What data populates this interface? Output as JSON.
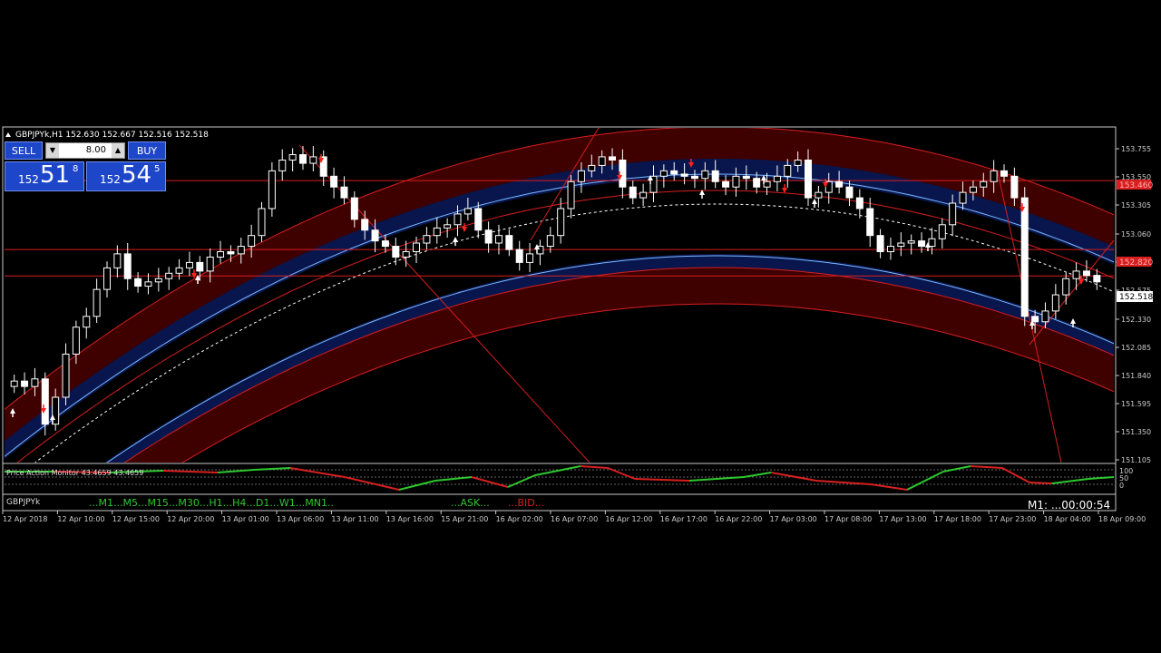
{
  "chart": {
    "header": "GBPJPYk,H1  152.630 152.667 152.516 152.518",
    "symbol_label": "GBPJPYk",
    "current_price_label": "152.518",
    "hline_labels": [
      "153.460",
      "152.820"
    ],
    "timer_label": "M1: ...00:00:54"
  },
  "trade_panel": {
    "sell_label": "SELL",
    "buy_label": "BUY",
    "lot": "8.00",
    "sell_small": "152",
    "sell_big": "51",
    "sell_sup": "8",
    "buy_small": "152",
    "buy_big": "54",
    "buy_sup": "5"
  },
  "indicator": {
    "label": "Price Action Monitor 43.4659 43.4659",
    "levels": [
      "100",
      "50",
      "0"
    ]
  },
  "timeframes": {
    "text": "...M1...M5...M15...M30...H1...H4...D1...W1...MN1..",
    "ask": "...ASK...",
    "bid": "...BID..."
  },
  "price_axis": [
    "153.755",
    "153.550",
    "153.305",
    "153.060",
    "152.820",
    "152.575",
    "152.330",
    "152.085",
    "151.840",
    "151.595",
    "151.350",
    "151.105"
  ],
  "time_axis": [
    "12 Apr 2018",
    "12 Apr 10:00",
    "12 Apr 15:00",
    "12 Apr 20:00",
    "13 Apr 01:00",
    "13 Apr 06:00",
    "13 Apr 11:00",
    "13 Apr 16:00",
    "15 Apr 21:00",
    "16 Apr 02:00",
    "16 Apr 07:00",
    "16 Apr 12:00",
    "16 Apr 17:00",
    "16 Apr 22:00",
    "17 Apr 03:00",
    "17 Apr 08:00",
    "17 Apr 13:00",
    "17 Apr 18:00",
    "17 Apr 23:00",
    "18 Apr 04:00",
    "18 Apr 09:00"
  ],
  "colors": {
    "background": "#000000",
    "bull": "#ffffff",
    "band_red": "#4a0000",
    "band_blue": "#0a1a5a",
    "line_red": "#d81e1e",
    "panel_blue": "#1e46c8",
    "green": "#2ec82e",
    "red_ind": "#d82020"
  },
  "chart_data": {
    "type": "candlestick",
    "symbol": "GBPJPYk",
    "timeframe": "H1",
    "ohlc_header": {
      "open": 152.63,
      "high": 152.667,
      "low": 152.516,
      "close": 152.518
    },
    "ylim": [
      151.105,
      153.9
    ],
    "closes": [
      151.6,
      151.55,
      151.62,
      151.2,
      151.45,
      151.85,
      152.1,
      152.2,
      152.45,
      152.65,
      152.78,
      152.55,
      152.48,
      152.52,
      152.55,
      152.6,
      152.65,
      152.7,
      152.62,
      152.75,
      152.8,
      152.78,
      152.85,
      152.95,
      153.2,
      153.55,
      153.65,
      153.7,
      153.62,
      153.68,
      153.5,
      153.4,
      153.3,
      153.1,
      153.0,
      152.9,
      152.85,
      152.75,
      152.8,
      152.88,
      152.95,
      153.02,
      153.05,
      153.15,
      153.2,
      153.0,
      152.88,
      152.95,
      152.82,
      152.7,
      152.78,
      152.85,
      152.95,
      153.2,
      153.45,
      153.55,
      153.6,
      153.68,
      153.65,
      153.4,
      153.3,
      153.35,
      153.5,
      153.55,
      153.52,
      153.5,
      153.48,
      153.55,
      153.45,
      153.4,
      153.5,
      153.48,
      153.4,
      153.45,
      153.5,
      153.6,
      153.65,
      153.3,
      153.35,
      153.45,
      153.4,
      153.3,
      153.2,
      152.95,
      152.8,
      152.85,
      152.88,
      152.9,
      152.85,
      152.92,
      153.05,
      153.25,
      153.35,
      153.4,
      153.45,
      153.55,
      153.5,
      153.3,
      152.2,
      152.15,
      152.25,
      152.4,
      152.55,
      152.62,
      152.58,
      152.52
    ],
    "horizontal_levels": [
      153.46,
      152.82,
      152.575
    ],
    "current_price": 152.518
  }
}
